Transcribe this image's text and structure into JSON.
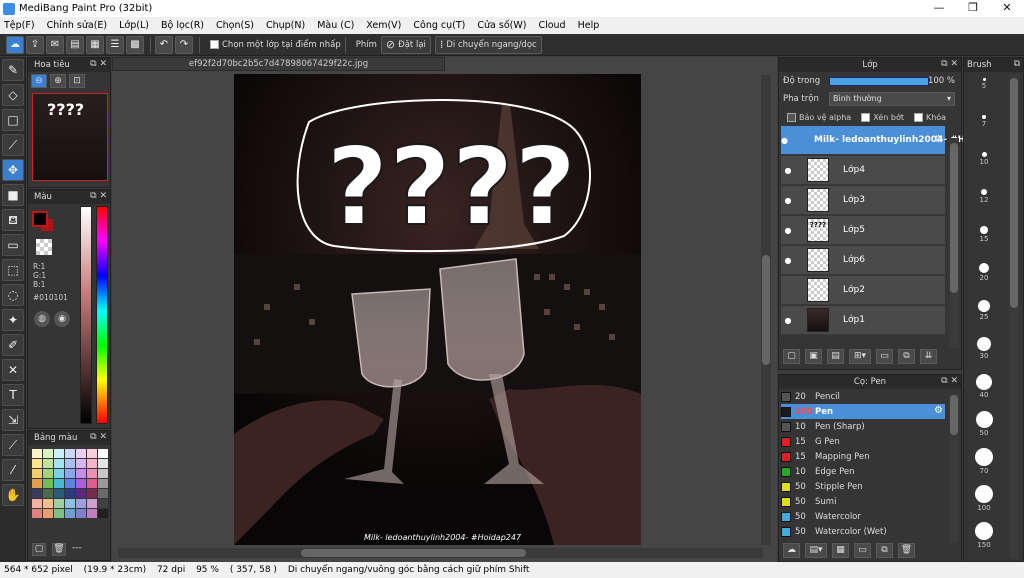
{
  "window": {
    "title": "MediBang Paint Pro (32bit)",
    "controls": [
      "—",
      "❐",
      "✕"
    ]
  },
  "menu": [
    "Tệp(F)",
    "Chỉnh sửa(E)",
    "Lớp(L)",
    "Bộ lọc(R)",
    "Chọn(S)",
    "Chụp(N)",
    "Màu (C)",
    "Xem(V)",
    "Công cụ(T)",
    "Cửa số(W)",
    "Cloud",
    "Help"
  ],
  "toolbar": {
    "snap_label": "Chọn một lớp tại điểm nhấp",
    "snap_group_label": "Phím",
    "reset_label": "Đặt lại",
    "move_label": "Di chuyển ngang/dọc"
  },
  "navigator": {
    "title": "Hoa tiêu",
    "thumb_text": "????"
  },
  "color": {
    "title": "Màu",
    "r": "R:1",
    "g": "G:1",
    "b": "B:1",
    "hex": "#010101",
    "fg": "#010101",
    "bg": "#aa1515"
  },
  "palette": {
    "title": "Bảng màu",
    "more": "---",
    "swatches": [
      "#fff5c8",
      "#d9f2c4",
      "#c8f0f5",
      "#cbd6f7",
      "#e9cff5",
      "#f7cfd9",
      "#ffffff",
      "#fde68a",
      "#bfe3a0",
      "#a7e3ee",
      "#a9bff2",
      "#d8b4f0",
      "#f3b4c8",
      "#e5e5e5",
      "#f5d06a",
      "#9fd67c",
      "#7dd3e6",
      "#8ba6ec",
      "#c68ee8",
      "#ec8fb0",
      "#c8c8c8",
      "#e0a24a",
      "#6fbf55",
      "#48b8d6",
      "#5d82e0",
      "#a463d6",
      "#de5d8c",
      "#9a9a9a",
      "#3a3a5a",
      "#4a6a4a",
      "#2a5a7a",
      "#2a3a7a",
      "#5a2a7a",
      "#7a2a4a",
      "#6a6a6a",
      "#f5b0a0",
      "#f0c090",
      "#a0d0a0",
      "#90c0e0",
      "#a0a0e0",
      "#d0a0d0",
      "#404040",
      "#e08080",
      "#e0a070",
      "#80c080",
      "#70a0d0",
      "#8080d0",
      "#c080c0",
      "#202020"
    ]
  },
  "document": {
    "tab_name": "ef92f2d70bc2b5c7d47898067429f22c.jpg",
    "question_marks": "????",
    "watermark": "Milk- ledoanthuylinh2004- #Hoidap247"
  },
  "layers": {
    "title": "Lớp",
    "opacity_label": "Độ trong",
    "opacity_value": "100 %",
    "opacity": 1.0,
    "blend_label": "Pha trộn",
    "blend_value": "Bình thường",
    "protect_alpha": "Bảo vệ alpha",
    "clipping": "Xén bớt",
    "lock": "Khóa",
    "items": [
      {
        "name": "Milk- ledoanthuylinh2004- #Hoidap247",
        "selected": true,
        "visible": true,
        "thumb": ""
      },
      {
        "name": "Lớp4",
        "selected": false,
        "visible": true,
        "thumb": ""
      },
      {
        "name": "Lớp3",
        "selected": false,
        "visible": true,
        "thumb": ""
      },
      {
        "name": "Lớp5",
        "selected": false,
        "visible": true,
        "thumb": "????"
      },
      {
        "name": "Lớp6",
        "selected": false,
        "visible": true,
        "thumb": ""
      },
      {
        "name": "Lớp2",
        "selected": false,
        "visible": false,
        "thumb": ""
      },
      {
        "name": "Lớp1",
        "selected": false,
        "visible": true,
        "thumb": "photo"
      }
    ]
  },
  "brushes": {
    "title": "Cọ: Pen",
    "items": [
      {
        "size": "20",
        "name": "Pencil",
        "color": "#555555",
        "selected": false
      },
      {
        "size": "200",
        "name": "Pen",
        "color": "#1a1a1a",
        "selected": true
      },
      {
        "size": "10",
        "name": "Pen (Sharp)",
        "color": "#555555",
        "selected": false
      },
      {
        "size": "15",
        "name": "G Pen",
        "color": "#dd2222",
        "selected": false
      },
      {
        "size": "15",
        "name": "Mapping Pen",
        "color": "#dd2222",
        "selected": false
      },
      {
        "size": "10",
        "name": "Edge Pen",
        "color": "#22aa22",
        "selected": false
      },
      {
        "size": "50",
        "name": "Stipple Pen",
        "color": "#dddd22",
        "selected": false
      },
      {
        "size": "50",
        "name": "Sumi",
        "color": "#dddd22",
        "selected": false
      },
      {
        "size": "50",
        "name": "Watercolor",
        "color": "#44aadd",
        "selected": false
      },
      {
        "size": "50",
        "name": "Watercolor (Wet)",
        "color": "#44aadd",
        "selected": false
      }
    ]
  },
  "brush_sizes": {
    "title": "Brush",
    "items": [
      "5",
      "7",
      "10",
      "12",
      "15",
      "20",
      "25",
      "30",
      "40",
      "50",
      "70",
      "100",
      "150"
    ]
  },
  "status": {
    "size": "564 * 652 pixel",
    "size_cm": "(19.9 * 23cm)",
    "dpi": "72 dpi",
    "zoom": "95 %",
    "coords": "( 357, 58 )",
    "hint": "Di chuyển ngang/vuông góc bằng cách giữ phím Shift"
  }
}
